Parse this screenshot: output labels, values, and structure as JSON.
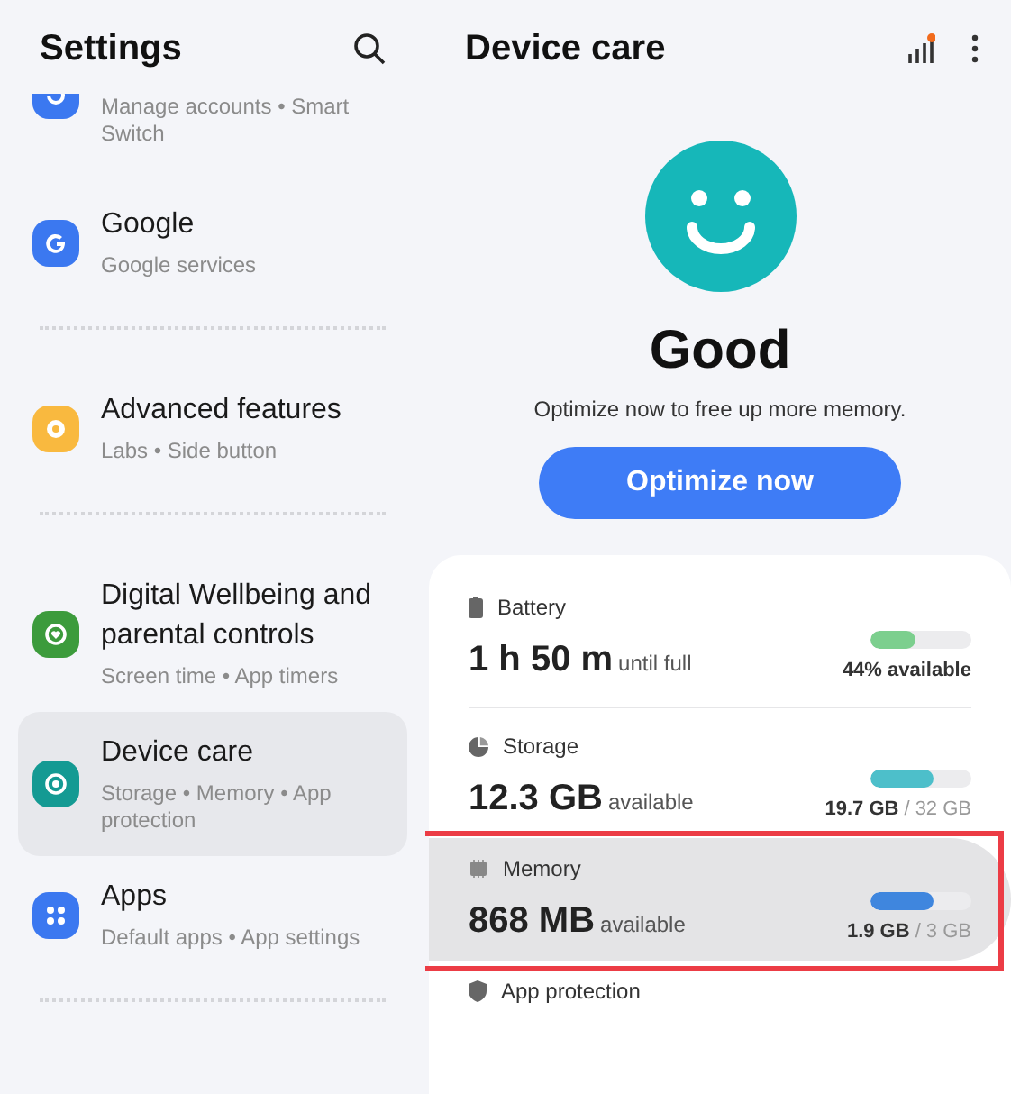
{
  "settings_panel": {
    "title": "Settings",
    "items": [
      {
        "kind": "cut",
        "subtitle": "Manage accounts • Smart Switch",
        "color": "#3b78f0",
        "selected": false,
        "divider_after": false
      },
      {
        "kind": "full",
        "title": "Google",
        "subtitle": "Google services",
        "color": "#3b78f0",
        "selected": false,
        "divider_after": true
      },
      {
        "kind": "full",
        "title": "Advanced features",
        "subtitle": "Labs • Side button",
        "color": "#f9b93f",
        "selected": false,
        "divider_after": true
      },
      {
        "kind": "full",
        "title": "Digital Wellbeing and parental controls",
        "subtitle": "Screen time • App timers",
        "color": "#3c9b3c",
        "selected": false,
        "divider_after": false
      },
      {
        "kind": "full",
        "title": "Device care",
        "subtitle": "Storage • Memory • App protection",
        "color": "#149a93",
        "selected": true,
        "divider_after": false
      },
      {
        "kind": "full",
        "title": "Apps",
        "subtitle": "Default apps • App settings",
        "color": "#3b78f0",
        "selected": false,
        "divider_after": true
      }
    ]
  },
  "device_care": {
    "title": "Device care",
    "status": "Good",
    "message": "Optimize now to free up more memory.",
    "button": "Optimize now",
    "notification_dot": true,
    "rows": [
      {
        "label": "Battery",
        "value": "1 h 50 m",
        "unit": "until full",
        "level": 0.44,
        "color": "#7ccf8e",
        "reading": "44% available",
        "selected": false
      },
      {
        "label": "Storage",
        "value": "12.3 GB",
        "unit": "available",
        "level": 0.62,
        "color": "#4dbfca",
        "used": "19.7 GB",
        "total": "/ 32 GB",
        "selected": false
      },
      {
        "label": "Memory",
        "value": "868 MB",
        "unit": "available",
        "level": 0.63,
        "color": "#3f86de",
        "used": "1.9 GB",
        "total": "/ 3 GB",
        "selected": true
      },
      {
        "label": "App protection",
        "selected": false
      }
    ]
  }
}
